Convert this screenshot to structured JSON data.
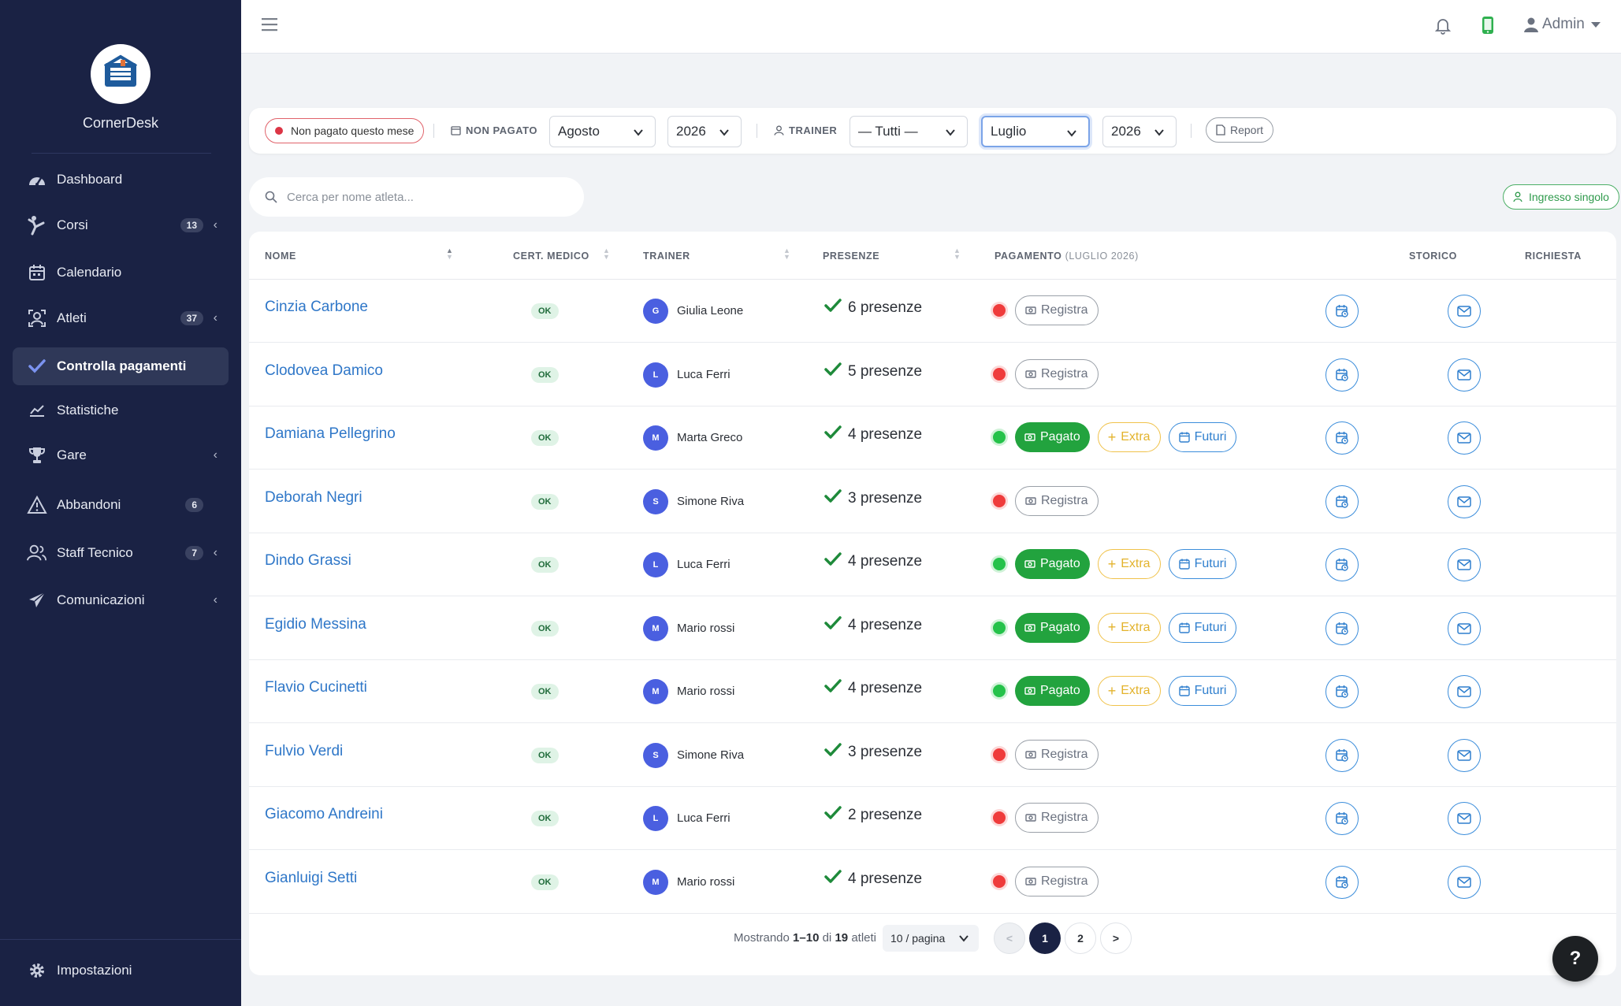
{
  "app": {
    "brand": "CornerDesk"
  },
  "sidebar": {
    "items": [
      {
        "label": "Dashboard",
        "icon": "gauge-icon"
      },
      {
        "label": "Corsi",
        "badge": "13",
        "icon": "kick-icon"
      },
      {
        "label": "Calendario",
        "icon": "calendar-icon"
      },
      {
        "label": "Atleti",
        "badge": "37",
        "icon": "user-badge-icon"
      },
      {
        "label": "Controlla pagamenti",
        "icon": "check-icon"
      },
      {
        "label": "Statistiche",
        "icon": "chart-line-icon"
      },
      {
        "label": "Gare",
        "icon": "trophy-icon"
      },
      {
        "label": "Abbandoni",
        "badge": "6",
        "icon": "warning-icon"
      },
      {
        "label": "Staff Tecnico",
        "badge": "7",
        "icon": "users-icon"
      },
      {
        "label": "Comunicazioni",
        "icon": "send-icon"
      }
    ],
    "settings": "Impostazioni"
  },
  "topbar": {
    "user": "Admin"
  },
  "filters": {
    "unpaid_pill": "Non pagato questo mese",
    "unpaid_label": "NON PAGATO",
    "unpaid_month": "Agosto",
    "unpaid_year": "2026",
    "trainer_label": "TRAINER",
    "trainer_value": "— Tutti —",
    "month": "Luglio",
    "year": "2026",
    "report": "Report"
  },
  "search": {
    "placeholder": "Cerca per nome atleta..."
  },
  "ingresso": "Ingresso singolo",
  "table": {
    "headers": {
      "nome": "NOME",
      "cert": "CERT. MEDICO",
      "trainer": "TRAINER",
      "presenze": "PRESENZE",
      "pagamento": "PAGAMENTO",
      "pagamento_sub": "(LUGLIO 2026)",
      "storico": "STORICO",
      "richiesta": "RICHIESTA"
    },
    "rows": [
      {
        "name": "Cinzia Carbone",
        "cert": "OK",
        "initial": "G",
        "trainer": "Giulia Leone",
        "presenze": "6 presenze",
        "paid": false
      },
      {
        "name": "Clodovea Damico",
        "cert": "OK",
        "initial": "L",
        "trainer": "Luca Ferri",
        "presenze": "5 presenze",
        "paid": false
      },
      {
        "name": "Damiana Pellegrino",
        "cert": "OK",
        "initial": "M",
        "trainer": "Marta Greco",
        "presenze": "4 presenze",
        "paid": true
      },
      {
        "name": "Deborah Negri",
        "cert": "OK",
        "initial": "S",
        "trainer": "Simone Riva",
        "presenze": "3 presenze",
        "paid": false
      },
      {
        "name": "Dindo Grassi",
        "cert": "OK",
        "initial": "L",
        "trainer": "Luca Ferri",
        "presenze": "4 presenze",
        "paid": true
      },
      {
        "name": "Egidio Messina",
        "cert": "OK",
        "initial": "M",
        "trainer": "Mario rossi",
        "presenze": "4 presenze",
        "paid": true
      },
      {
        "name": "Flavio Cucinetti",
        "cert": "OK",
        "initial": "M",
        "trainer": "Mario rossi",
        "presenze": "4 presenze",
        "paid": true
      },
      {
        "name": "Fulvio Verdi",
        "cert": "OK",
        "initial": "S",
        "trainer": "Simone Riva",
        "presenze": "3 presenze",
        "paid": false
      },
      {
        "name": "Giacomo Andreini",
        "cert": "OK",
        "initial": "L",
        "trainer": "Luca Ferri",
        "presenze": "2 presenze",
        "paid": false
      },
      {
        "name": "Gianluigi Setti",
        "cert": "OK",
        "initial": "M",
        "trainer": "Mario rossi",
        "presenze": "4 presenze",
        "paid": false
      }
    ],
    "labels": {
      "registra": "Registra",
      "pagato": "Pagato",
      "extra": "Extra",
      "futuri": "Futuri"
    }
  },
  "pagination": {
    "prefix": "Mostrando",
    "range": "1–10",
    "of": "di",
    "total": "19",
    "suffix": "atleti",
    "per_page": "10 / pagina",
    "prev": "<",
    "pages": [
      "1",
      "2"
    ],
    "next": ">",
    "current": "1"
  },
  "help": "?"
}
